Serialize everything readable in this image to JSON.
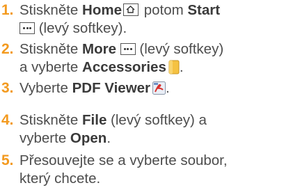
{
  "steps": [
    {
      "number": "1.",
      "line1": {
        "t1": "Stiskněte ",
        "b1": "Home",
        "t2": " potom ",
        "b2": "Start"
      },
      "line2": {
        "t1": " (levý softkey)."
      }
    },
    {
      "number": "2.",
      "line1": {
        "t1": "Stiskněte ",
        "b1": "More",
        "t2": " (levý softkey)"
      },
      "line2": {
        "t1": "a vyberte ",
        "b1": "Accessories",
        "t2": "."
      }
    },
    {
      "number": "3.",
      "line1": {
        "t1": "Vyberte ",
        "b1": "PDF Viewer",
        "t2": "."
      }
    },
    {
      "number": "4.",
      "line1": {
        "t1": "Stiskněte ",
        "b1": "File",
        "t2": " (levý softkey) a"
      },
      "line2": {
        "t1": "vyberte ",
        "b1": "Open",
        "t2": "."
      }
    },
    {
      "number": "5.",
      "line1": {
        "t1": "Přesouvejte se a vyberte soubor,"
      },
      "line2": {
        "t1": "který chcete."
      }
    }
  ],
  "icons": {
    "home": "home-key-icon",
    "softkey": "more-dots-key-icon",
    "accessories": "folder-icon",
    "pdf_viewer": "pdf-viewer-icon"
  },
  "colors": {
    "number": "#f39a1f",
    "text": "#4d4d4d",
    "bold": "#3a3a3a",
    "folder": "#f5c242"
  }
}
